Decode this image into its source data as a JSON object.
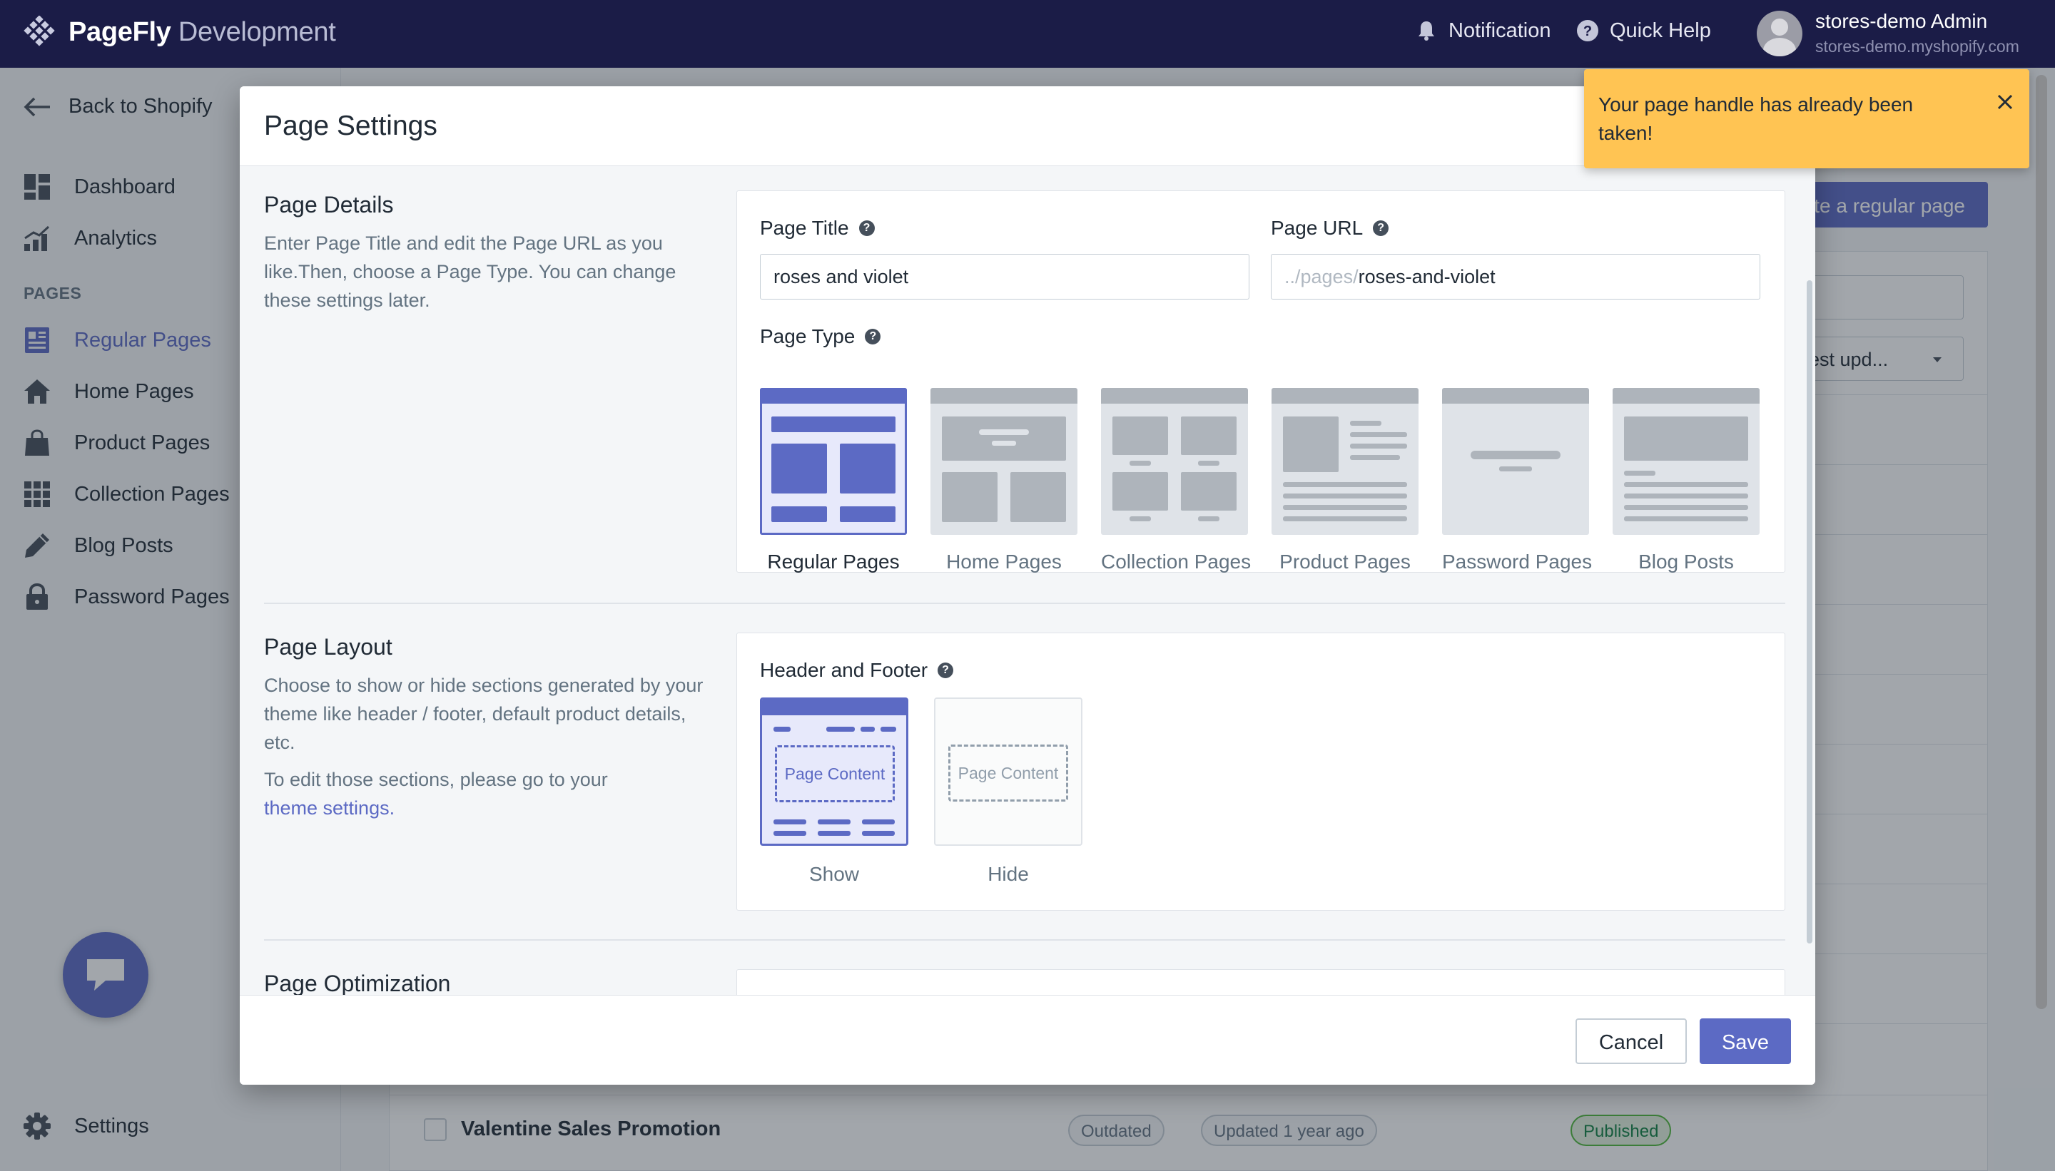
{
  "topbar": {
    "brand_bold": "PageFly",
    "brand_light": "Development",
    "notification_label": "Notification",
    "quick_help_label": "Quick Help",
    "user_name": "stores-demo Admin",
    "user_domain": "stores-demo.myshopify.com"
  },
  "sidebar": {
    "back_label": "Back to Shopify",
    "section_label": "PAGES",
    "items": [
      {
        "label": "Dashboard",
        "icon": "dashboard-icon"
      },
      {
        "label": "Analytics",
        "icon": "analytics-icon"
      },
      {
        "label": "Regular Pages",
        "icon": "regular-pages-icon",
        "active": true
      },
      {
        "label": "Home Pages",
        "icon": "home-icon"
      },
      {
        "label": "Product Pages",
        "icon": "shopping-bag-icon"
      },
      {
        "label": "Collection Pages",
        "icon": "grid-icon"
      },
      {
        "label": "Blog Posts",
        "icon": "pencil-icon"
      },
      {
        "label": "Password Pages",
        "icon": "lock-icon"
      }
    ],
    "settings_label": "Settings"
  },
  "background": {
    "create_button_label": "te a regular page",
    "sort_label": "est upd...",
    "last_row": {
      "title": "Valentine Sales Promotion",
      "status": "Outdated",
      "updated": "Updated 1 year ago",
      "publish_status": "Published"
    }
  },
  "modal": {
    "title": "Page Settings",
    "page_details": {
      "title": "Page Details",
      "description": "Enter Page Title and edit the Page URL as you like.Then, choose a Page Type. You can change these settings later.",
      "page_title_label": "Page Title",
      "page_title_value": "roses and violet",
      "page_url_label": "Page URL",
      "page_url_prefix": "../pages/",
      "page_url_value": "roses-and-violet",
      "page_type_label": "Page Type",
      "page_types": [
        {
          "label": "Regular Pages",
          "selected": true
        },
        {
          "label": "Home Pages",
          "selected": false
        },
        {
          "label": "Collection Pages",
          "selected": false
        },
        {
          "label": "Product Pages",
          "selected": false
        },
        {
          "label": "Password Pages",
          "selected": false
        },
        {
          "label": "Blog Posts",
          "selected": false
        }
      ]
    },
    "page_layout": {
      "title": "Page Layout",
      "description": "Choose to show or hide sections generated by your theme like header / footer, default product details, etc.",
      "edit_note": "To edit those sections, please go to your",
      "edit_link": "theme settings.",
      "header_footer_label": "Header and Footer",
      "content_text": "Page Content",
      "show_label": "Show",
      "hide_label": "Hide",
      "selected": "Show"
    },
    "page_optimization": {
      "title": "Page Optimization"
    },
    "cancel_label": "Cancel",
    "save_label": "Save"
  },
  "toast": {
    "message": "Your page handle has already been taken!"
  },
  "colors": {
    "topbar": "#1b1c47",
    "accent": "#5c6ac4",
    "toast": "#ffc453"
  }
}
